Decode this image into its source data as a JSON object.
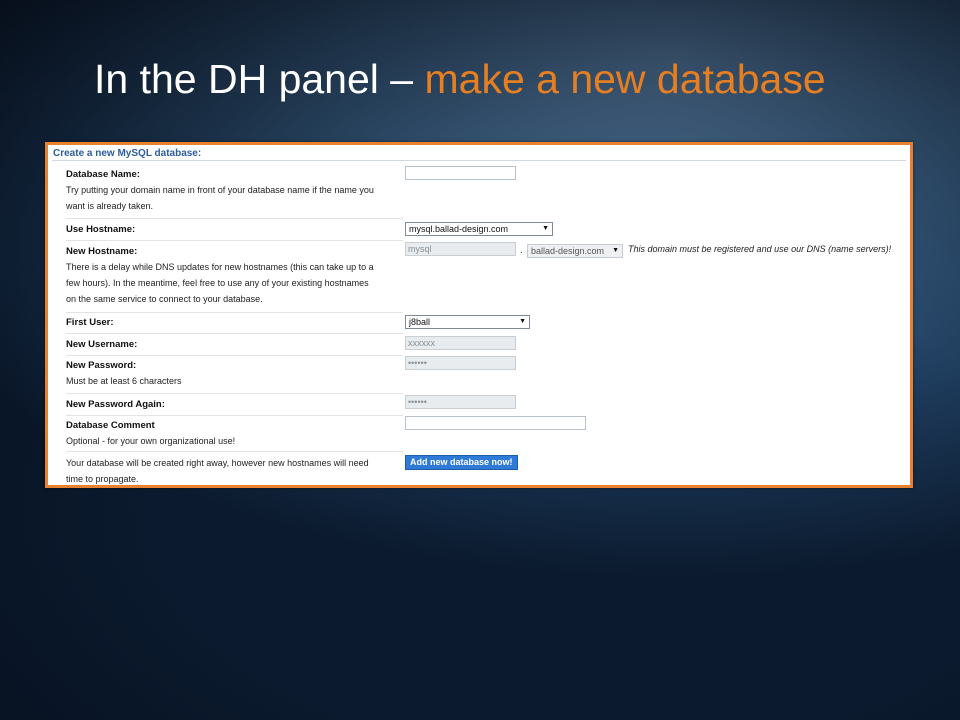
{
  "slide": {
    "title_main": "In the DH panel – ",
    "title_accent": "make a new database"
  },
  "form": {
    "header": "Create a new MySQL database:",
    "database_name": {
      "label": "Database Name:",
      "help_1": "Try putting your domain name in front of your database name if the name you",
      "help_2": "want is already taken.",
      "value": ""
    },
    "use_hostname": {
      "label": "Use Hostname:",
      "selected": "mysql.ballad-design.com"
    },
    "new_hostname": {
      "label": "New Hostname:",
      "help_1": "There is a delay while DNS updates for new hostnames (this can take up to a",
      "help_2": "few hours). In the meantime, feel free to use any of your existing hostnames",
      "help_3": "on the same service to connect to your database.",
      "prefix_value": "mysql",
      "separator": ".",
      "domain_selected": "ballad-design.com",
      "note": "This domain must be registered and use our DNS (name servers)!"
    },
    "first_user": {
      "label": "First User:",
      "selected": "j8ball"
    },
    "new_username": {
      "label": "New Username:",
      "value": "xxxxxx"
    },
    "new_password": {
      "label": "New Password:",
      "help": "Must be at least 6 characters",
      "value": "••••••"
    },
    "new_password_again": {
      "label": "New Password Again:",
      "value": "••••••"
    },
    "database_comment": {
      "label": "Database Comment",
      "help": "Optional - for your own organizational use!",
      "value": ""
    },
    "footer": {
      "text_1": "Your database will be created right away, however new hostnames will need",
      "text_2": "time to propagate.",
      "submit_label": "Add new database now!"
    }
  }
}
